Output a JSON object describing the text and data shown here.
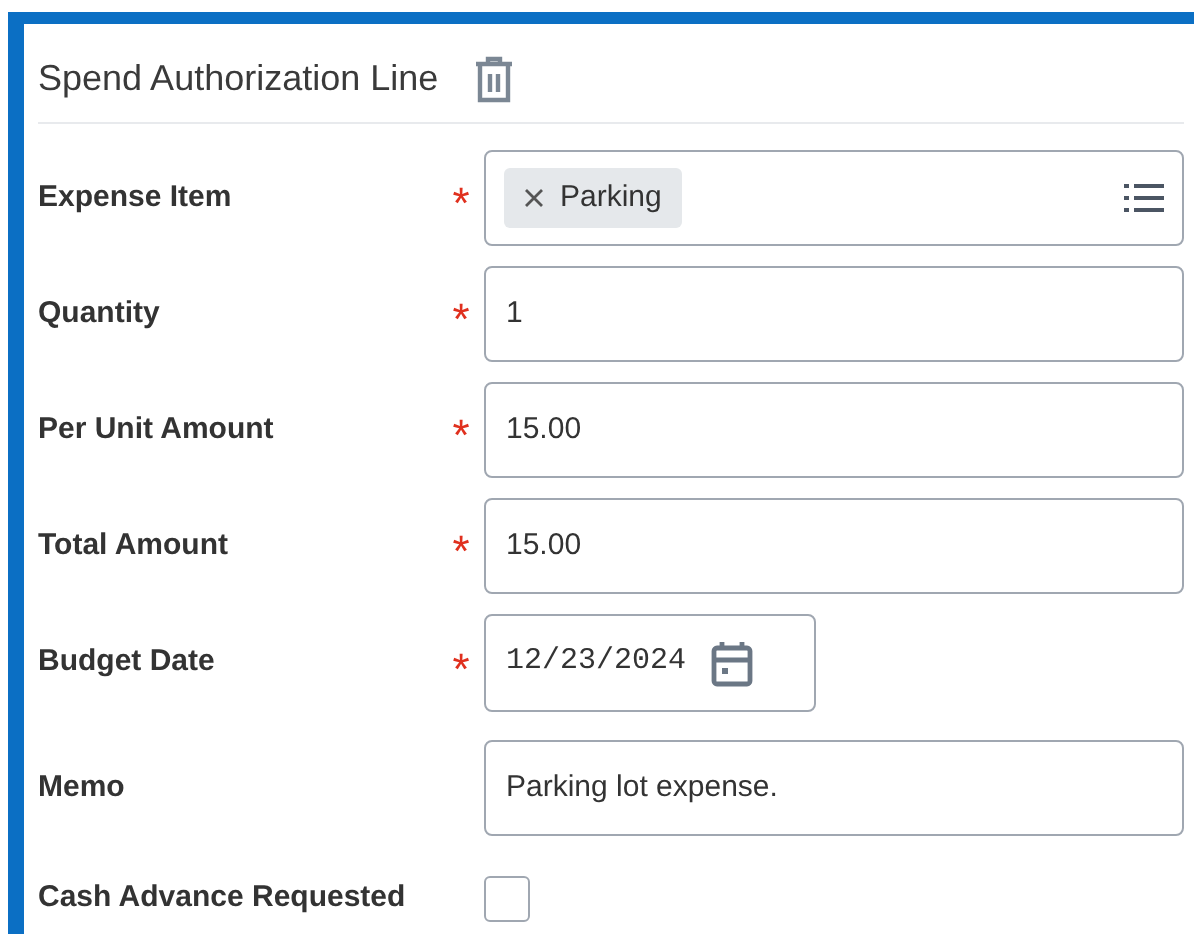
{
  "title": "Spend Authorization Line",
  "fields": [
    {
      "label": "Expense Item",
      "required_mark": "*",
      "kind": "multiselect",
      "tags": [
        "Parking"
      ]
    },
    {
      "label": "Quantity",
      "required_mark": "*",
      "kind": "text",
      "value": "1"
    },
    {
      "label": "Per Unit Amount",
      "required_mark": "*",
      "kind": "text",
      "value": "15.00"
    },
    {
      "label": "Total Amount",
      "required_mark": "*",
      "kind": "text",
      "value": "15.00"
    },
    {
      "label": "Budget Date",
      "required_mark": "*",
      "kind": "date",
      "value": "12/23/2024"
    },
    {
      "label": "Memo",
      "kind": "text",
      "value": "Parking lot expense."
    },
    {
      "label": "Cash Advance Requested",
      "kind": "checkbox",
      "checked": false
    }
  ]
}
